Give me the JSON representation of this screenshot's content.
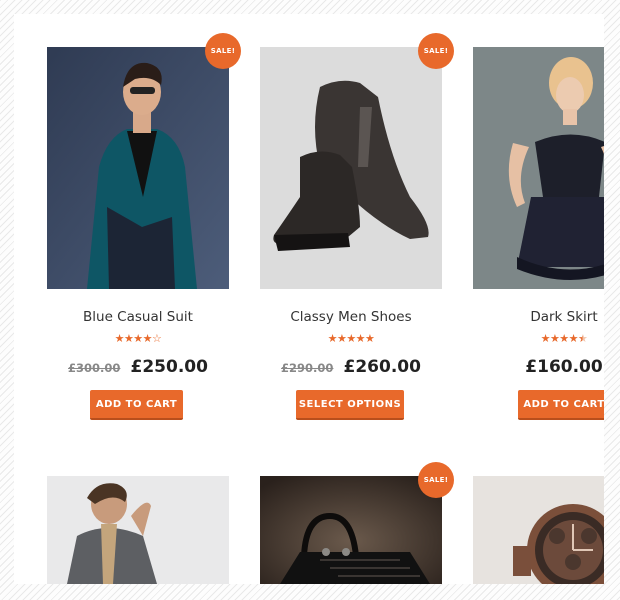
{
  "products": [
    {
      "title": "Blue Casual Suit",
      "rating": 4,
      "rating_display": "★★★★☆",
      "old_price": "£300.00",
      "price": "£250.00",
      "button": "ADD TO CART",
      "sale": "SALE!"
    },
    {
      "title": "Classy Men Shoes",
      "rating": 5,
      "rating_display": "★★★★★",
      "old_price": "£290.00",
      "price": "£260.00",
      "button": "SELECT OPTIONS",
      "sale": "SALE!"
    },
    {
      "title": "Dark Skirt",
      "rating": 4.5,
      "rating_display": "★★★★½",
      "old_price": "",
      "price": "£160.00",
      "button": "ADD TO CART",
      "sale": ""
    },
    {
      "title": "",
      "sale": ""
    },
    {
      "title": "",
      "sale": "SALE!"
    },
    {
      "title": "",
      "sale": ""
    }
  ],
  "colors": {
    "accent": "#e8692b",
    "accent_dark": "#b84e1c",
    "text": "#333333"
  }
}
